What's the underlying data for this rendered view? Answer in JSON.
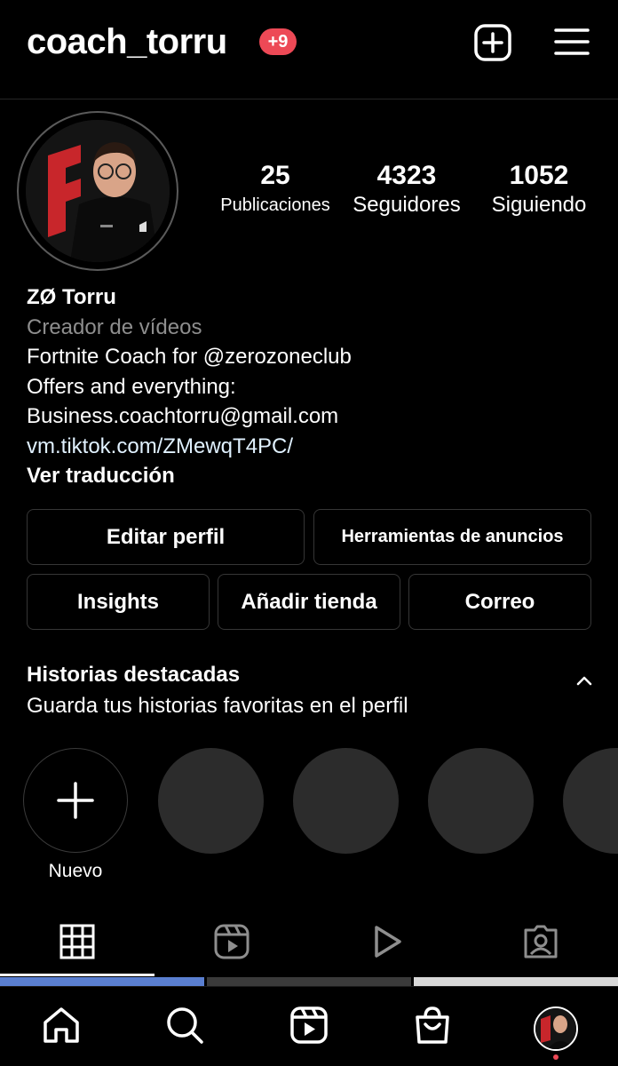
{
  "header": {
    "username": "coach_torru",
    "notification_badge": "+9",
    "new_post_icon": "plus-square-icon",
    "menu_icon": "hamburger-menu-icon"
  },
  "profile": {
    "avatar_icon": "profile-photo",
    "stats": [
      {
        "value": "25",
        "label": "Publicaciones"
      },
      {
        "value": "4323",
        "label": "Seguidores"
      },
      {
        "value": "1052",
        "label": "Siguiendo"
      }
    ]
  },
  "bio": {
    "name": "ZØ Torru",
    "category": "Creador de vídeos",
    "line1": "Fortnite Coach for @zerozoneclub",
    "line2": "Offers and everything:",
    "line3": "Business.coachtorru@gmail.com",
    "link": "vm.tiktok.com/ZMewqT4PC/",
    "translate": "Ver traducción"
  },
  "buttons": {
    "edit_profile": "Editar perfil",
    "ad_tools": "Herramientas de anuncios",
    "insights": "Insights",
    "add_shop": "Añadir tienda",
    "email": "Correo"
  },
  "highlights": {
    "title": "Historias destacadas",
    "subtitle": "Guarda tus historias favoritas en el perfil",
    "new_label": "Nuevo"
  },
  "tabs": [
    {
      "icon": "grid-icon",
      "active": true
    },
    {
      "icon": "reels-icon",
      "active": false
    },
    {
      "icon": "video-play-icon",
      "active": false
    },
    {
      "icon": "tagged-person-icon",
      "active": false
    }
  ],
  "bottom_nav": [
    "home-icon",
    "search-icon",
    "reels-icon",
    "shop-bag-icon",
    "profile-avatar-icon"
  ],
  "colors": {
    "background": "#000000",
    "badge": "#ed4956",
    "secondary_text": "#8e8e8e",
    "link": "#e0f1ff",
    "border": "#363636",
    "highlight_placeholder": "#2c2c2c"
  }
}
